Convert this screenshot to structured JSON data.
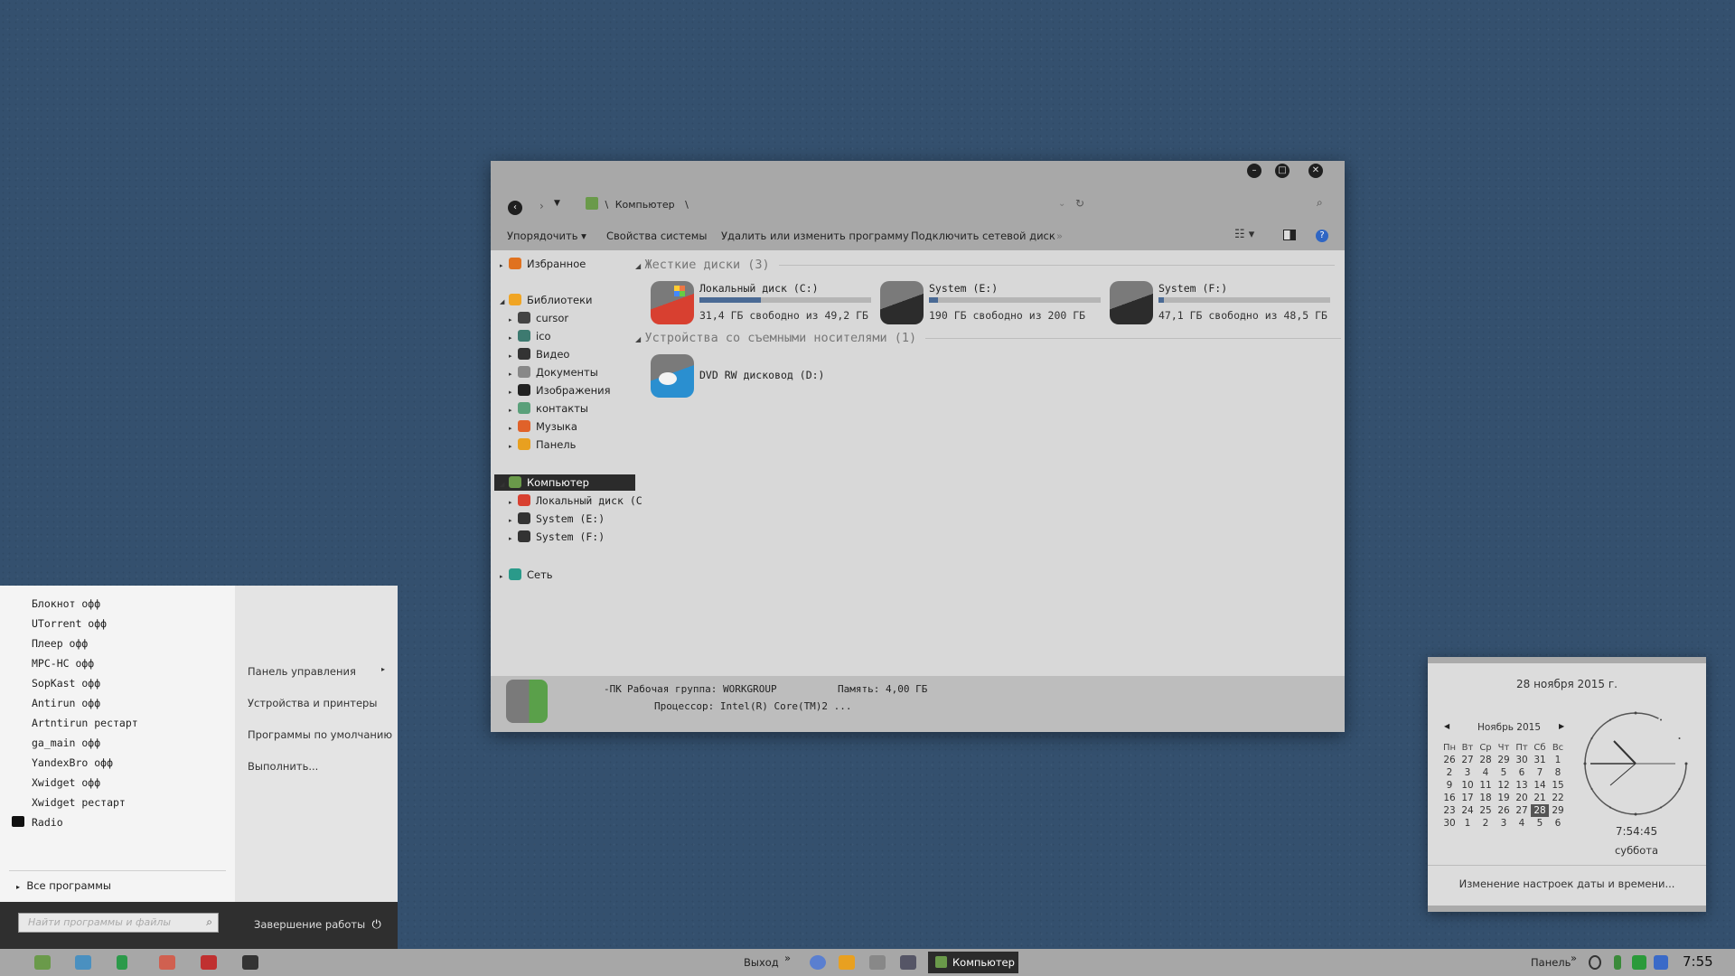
{
  "window": {
    "breadcrumb_root": "Компьютер",
    "breadcrumb_sep": "\\",
    "toolbar": [
      "Упорядочить",
      "Свойства системы",
      "Удалить или изменить программу",
      "Подключить сетевой диск"
    ],
    "toolbar_more": "»",
    "tree": {
      "favorites": "Избранное",
      "libraries": "Библиотеки",
      "lib_items": [
        "cursor",
        "ico",
        "Видео",
        "Документы",
        "Изображения",
        "контакты",
        "Музыка",
        "Панель"
      ],
      "computer": "Компьютер",
      "computer_items": [
        "Локальный диск (С",
        "System (E:)",
        "System (F:)"
      ],
      "network": "Сеть"
    },
    "groups": {
      "hard_disks": "Жесткие диски (3)",
      "removable": "Устройства со съемными носителями (1)"
    },
    "drives": [
      {
        "name": "Локальный диск (C:)",
        "free": "31,4 ГБ свободно из 49,2 ГБ",
        "used_fraction": 0.36
      },
      {
        "name": "System (E:)",
        "free": "190 ГБ свободно из 200 ГБ",
        "used_fraction": 0.05
      },
      {
        "name": "System (F:)",
        "free": "47,1 ГБ свободно из 48,5 ГБ",
        "used_fraction": 0.03
      }
    ],
    "dvd": {
      "name": "DVD RW дисковод (D:)"
    },
    "details": {
      "pc": "-ПК",
      "workgroup": "Рабочая группа: WORKGROUP",
      "memory": "Память: 4,00 ГБ",
      "cpu": "Процессор: Intel(R) Core(TM)2 ..."
    }
  },
  "start_menu": {
    "programs": [
      "Блокнот офф",
      "UTorrent офф",
      "Плеер офф",
      "MPC-HC офф",
      "SopKast офф",
      "Antirun офф",
      "Artntirun рестарт",
      "ga_main офф",
      "YandexBro офф",
      "Xwidget офф",
      "Xwidget рестарт",
      "Radio"
    ],
    "all_programs": "Все программы",
    "right_links": [
      "Панель управления",
      "Устройства и принтеры",
      "Программы по умолчанию",
      "Выполнить..."
    ],
    "search_placeholder": "Найти программы и файлы",
    "shutdown": "Завершение работы"
  },
  "calendar": {
    "date_full": "28 ноября 2015 г.",
    "month": "Ноябрь 2015",
    "weekdays": [
      "Пн",
      "Вт",
      "Ср",
      "Чт",
      "Пт",
      "Сб",
      "Вс"
    ],
    "weeks": [
      [
        "26",
        "27",
        "28",
        "29",
        "30",
        "31",
        "1"
      ],
      [
        "2",
        "3",
        "4",
        "5",
        "6",
        "7",
        "8"
      ],
      [
        "9",
        "10",
        "11",
        "12",
        "13",
        "14",
        "15"
      ],
      [
        "16",
        "17",
        "18",
        "19",
        "20",
        "21",
        "22"
      ],
      [
        "23",
        "24",
        "25",
        "26",
        "27",
        "28",
        "29"
      ],
      [
        "30",
        "1",
        "2",
        "3",
        "4",
        "5",
        "6"
      ]
    ],
    "time": "7:54:45",
    "day_name": "суббота",
    "settings_link": "Изменение настроек даты и времени..."
  },
  "taskbar": {
    "exit": "Выход",
    "more": "»",
    "active_window": "Компьютер",
    "panel": "Панель",
    "clock": "7:55"
  }
}
